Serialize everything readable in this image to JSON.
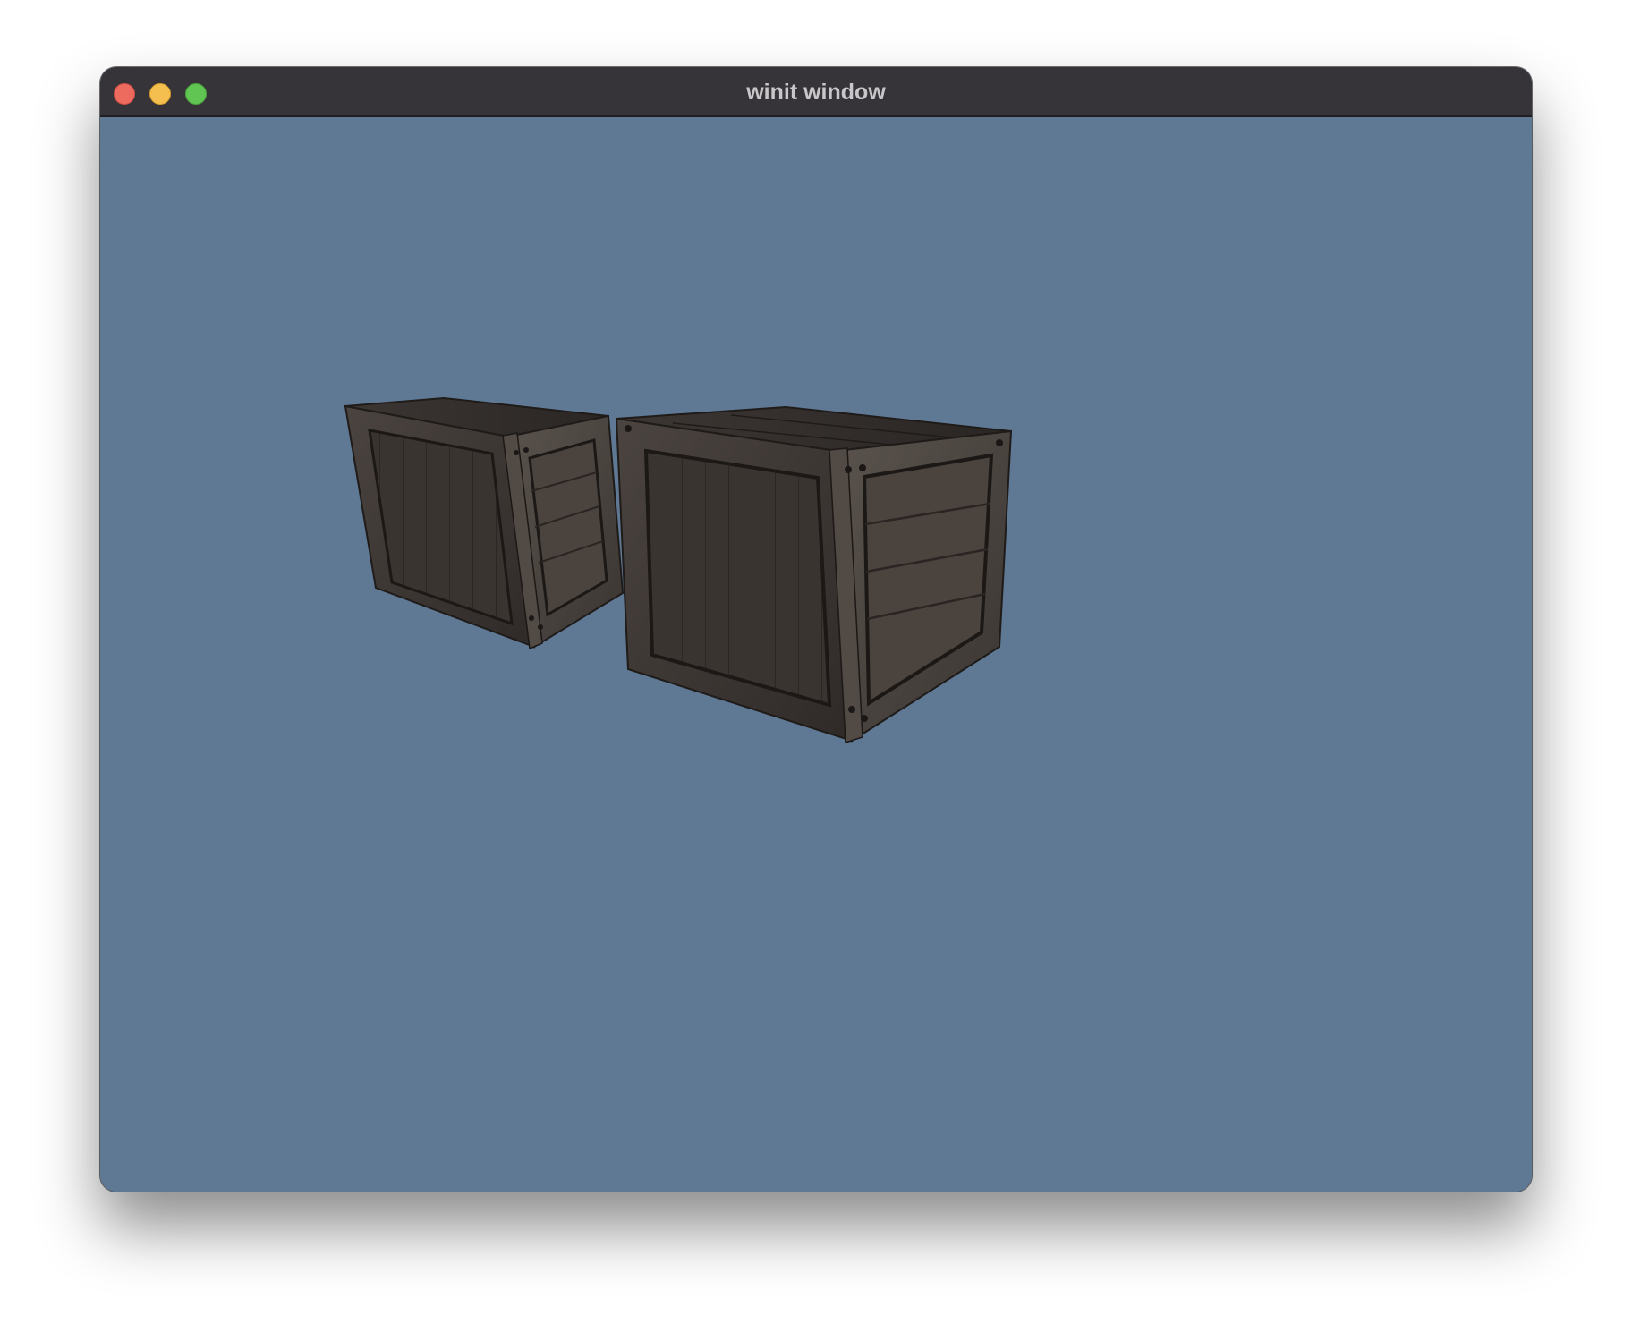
{
  "window": {
    "title": "winit window",
    "controls": {
      "close": "close-icon",
      "minimize": "minimize-icon",
      "maximize": "maximize-icon"
    }
  },
  "scene": {
    "background_color": "#5f7894",
    "objects": [
      "wooden-crate",
      "wooden-crate"
    ]
  }
}
